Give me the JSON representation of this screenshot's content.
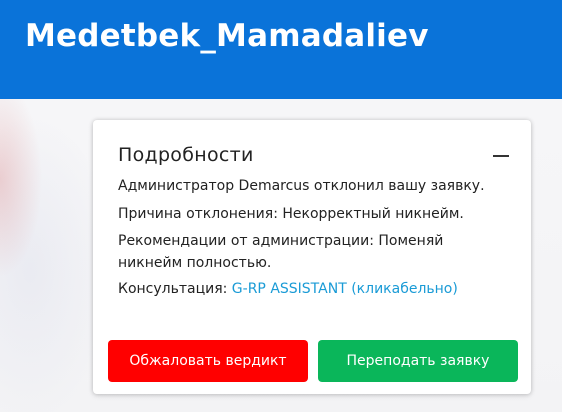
{
  "header": {
    "title": "Medetbek_Mamadaliev",
    "bg_color": "#0a73d9"
  },
  "card": {
    "title": "Подробности",
    "collapse_icon": "minus-icon",
    "lines": {
      "admin": "Администратор Demarcus отклонил вашу заявку.",
      "reason": "Причина отклонения: Некорректный никнейм.",
      "recommendation": "Рекомендации от администрации: Поменяй никнейм полностью.",
      "consult_label": "Консультация: ",
      "consult_link": "G-RP ASSISTANT (кликабельно)"
    },
    "link_color": "#1a9bd6"
  },
  "buttons": {
    "appeal": {
      "label": "Обжаловать вердикт",
      "color": "#ff0000"
    },
    "resubmit": {
      "label": "Переподать заявку",
      "color": "#0ab65a"
    }
  }
}
